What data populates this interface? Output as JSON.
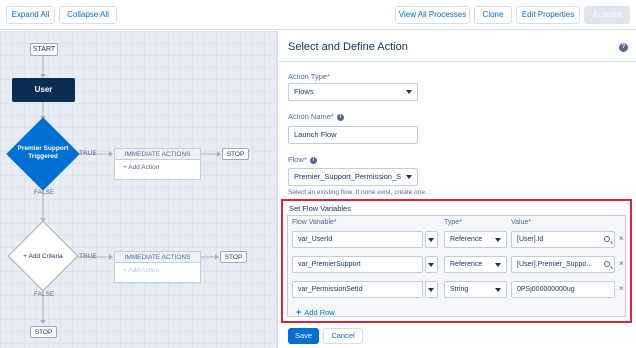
{
  "toolbar": {
    "expand_all": "Expand All",
    "collapse_all": "Collapse All",
    "view_all_processes": "View All Processes",
    "clone": "Clone",
    "edit_properties": "Edit Properties",
    "activate": "Activate"
  },
  "canvas": {
    "start": "START",
    "object": "User",
    "criteria1": "Premier Support Triggered",
    "criteria2": "+ Add Criteria",
    "true_label": "TRUE",
    "false_label": "FALSE",
    "immediate_actions": "IMMEDIATE ACTIONS",
    "add_action": "+ Add Action",
    "stop": "STOP"
  },
  "panel": {
    "title": "Select and Define Action",
    "help_icon": "?",
    "action_type_label": "Action Type*",
    "action_type_value": "Flows",
    "action_name_label": "Action Name*",
    "action_name_value": "Launch Flow",
    "flow_label": "Flow*",
    "flow_value": "Premier_Support_Permission_S",
    "flow_hint": "Select an existing flow. If none exist, create one.",
    "info_icon": "i"
  },
  "flow_variables": {
    "title": "Set Flow Variables",
    "headers": {
      "variable": "Flow Variable*",
      "type": "Type*",
      "value": "Value*"
    },
    "rows": [
      {
        "variable": "var_UserId",
        "type": "Reference",
        "value": "[User].Id"
      },
      {
        "variable": "var_PremierSupport",
        "type": "Reference",
        "value": "[User].Premier_Suppo..."
      },
      {
        "variable": "var_PermissionSetId",
        "type": "String",
        "value": "0PSj000000000ug"
      }
    ],
    "remove_icon": "×",
    "add_row": "Add Row"
  },
  "footer": {
    "save": "Save",
    "cancel": "Cancel"
  },
  "colors": {
    "accent": "#0070d2",
    "highlight": "#d5273d",
    "node_dark": "#0b2c53",
    "criteria": "#0070d2"
  }
}
